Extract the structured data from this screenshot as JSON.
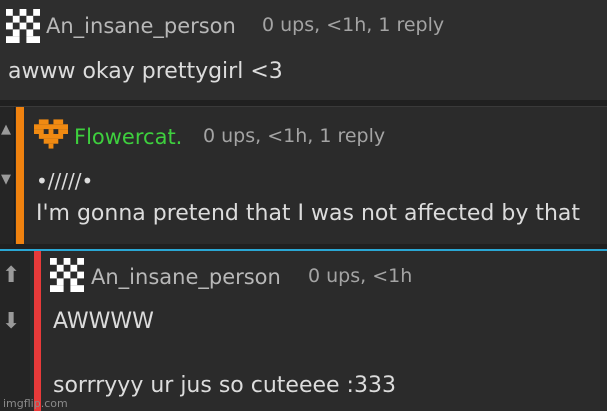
{
  "comments": [
    {
      "username": "An_insane_person",
      "meta": "0 ups, <1h, 1 reply",
      "lines": [
        "awww okay prettygirl <3"
      ],
      "avatar_icon": "checker-avatar-icon"
    },
    {
      "username": "Flowercat.",
      "meta": "0 ups, <1h, 1 reply",
      "lines": [
        "•/////•",
        "I'm gonna pretend that I was not affected by that"
      ],
      "username_color": "#3ecf3e",
      "accent_color": "#f0820f",
      "avatar_icon": "heart-avatar-icon"
    },
    {
      "username": "An_insane_person",
      "meta": "0 ups, <1h",
      "lines": [
        "AWWWW",
        "sorrryyy ur jus so cuteeee :333"
      ],
      "accent_color": "#e83a3a",
      "avatar_icon": "checker-avatar-icon"
    }
  ],
  "watermark": "imgflip.com",
  "colors": {
    "background": "#202020",
    "reply_border": "#2aa7d4",
    "username_default": "#b8b8b8",
    "meta_text": "#a4a4a4",
    "body_text": "#dcdcdc"
  }
}
